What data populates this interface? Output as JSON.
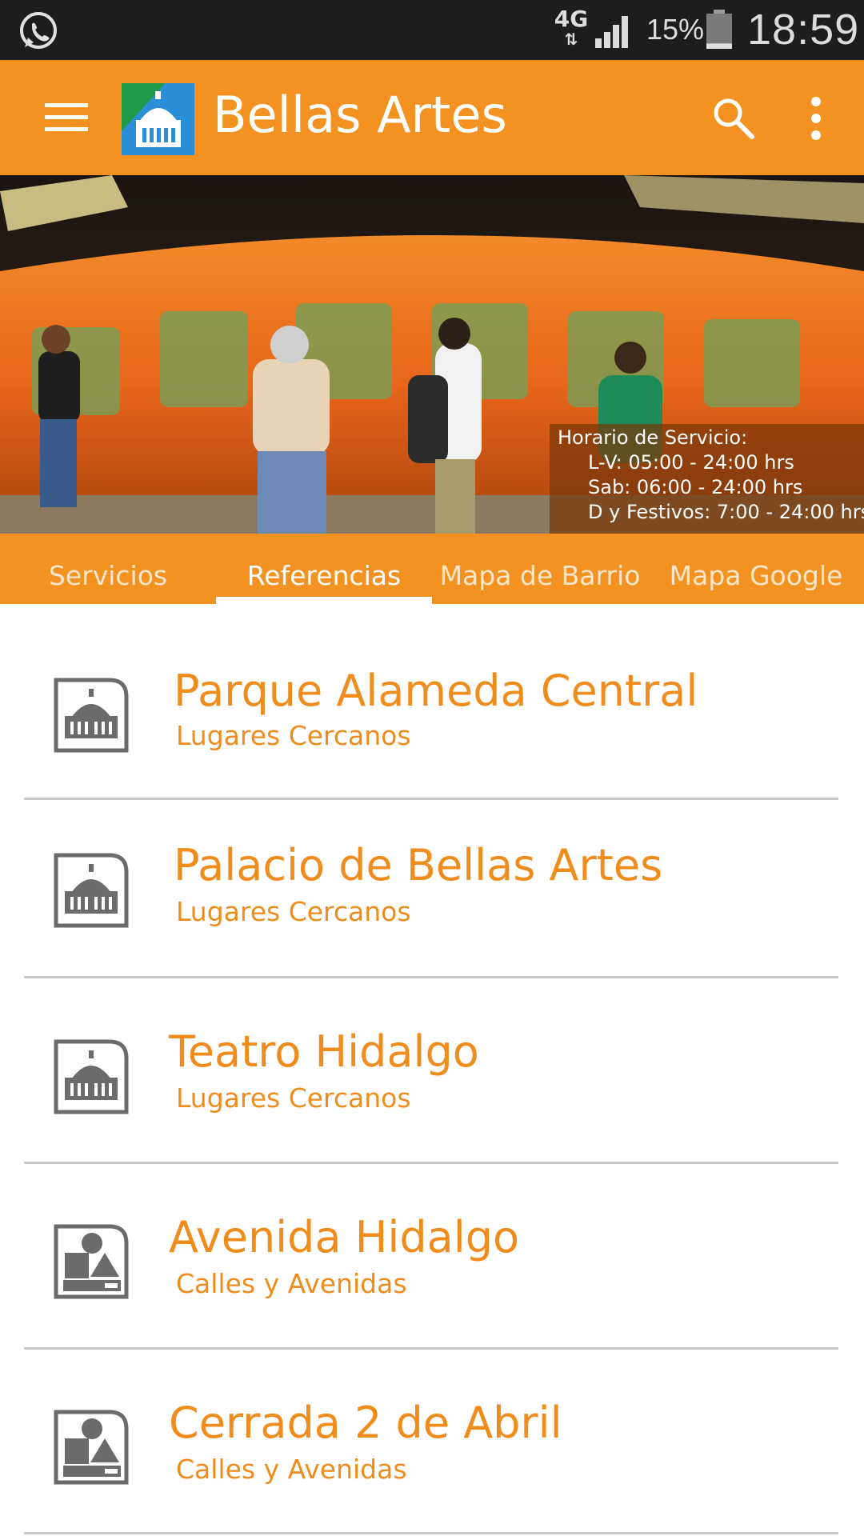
{
  "status_bar": {
    "network": "4G",
    "battery_percent": "15%",
    "battery_level": 0.15,
    "time": "18:59",
    "icons": [
      "whatsapp-icon",
      "network-arrows-icon",
      "signal-icon",
      "battery-icon"
    ]
  },
  "toolbar": {
    "title": "Bellas Artes",
    "icons": [
      "menu-icon",
      "app-logo-icon",
      "search-icon",
      "more-vert-icon"
    ]
  },
  "hero": {
    "schedule_title": "Horario de Servicio:",
    "schedule_lines": [
      "L-V: 05:00 - 24:00 hrs",
      "Sab: 06:00 - 24:00 hrs",
      "D y Festivos: 7:00 - 24:00 hrs"
    ]
  },
  "tabs": [
    {
      "label": "Servicios",
      "active": false
    },
    {
      "label": "Referencias",
      "active": true
    },
    {
      "label": "Mapa de Barrio",
      "active": false
    },
    {
      "label": "Mapa Google",
      "active": false
    }
  ],
  "list": [
    {
      "title": "Parque Alameda Central",
      "subtitle": "Lugares Cercanos",
      "icon": "palace-icon"
    },
    {
      "title": "Palacio de Bellas Artes",
      "subtitle": "Lugares Cercanos",
      "icon": "palace-icon"
    },
    {
      "title": "Teatro Hidalgo",
      "subtitle": "Lugares Cercanos",
      "icon": "palace-icon"
    },
    {
      "title": "Avenida Hidalgo",
      "subtitle": "Calles y Avenidas",
      "icon": "shapes-icon"
    },
    {
      "title": "Cerrada 2 de Abril",
      "subtitle": "Calles y Avenidas",
      "icon": "shapes-icon"
    }
  ],
  "colors": {
    "accent": "#f39221",
    "list_text": "#f08c1c",
    "status_bar": "#1d1d1d",
    "divider": "#c8c8c8",
    "icon_gray": "#6b6b6b"
  }
}
